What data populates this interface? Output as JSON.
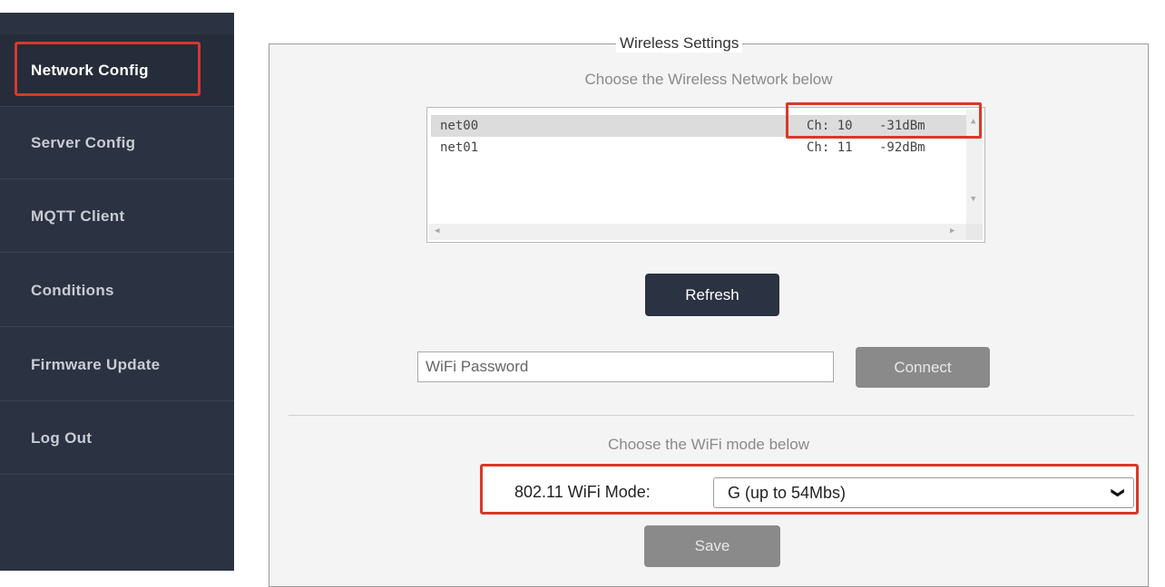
{
  "sidebar": {
    "items": [
      {
        "label": "Network Config",
        "active": true
      },
      {
        "label": "Server Config"
      },
      {
        "label": "MQTT Client"
      },
      {
        "label": "Conditions"
      },
      {
        "label": "Firmware Update"
      },
      {
        "label": "Log Out"
      }
    ]
  },
  "wireless": {
    "legend": "Wireless Settings",
    "choose_network": "Choose the Wireless Network below",
    "networks": [
      {
        "name": "net00",
        "channel": "Ch: 10",
        "signal": "-31dBm",
        "selected": true
      },
      {
        "name": "net01",
        "channel": "Ch: 11",
        "signal": "-92dBm"
      }
    ],
    "refresh_label": "Refresh",
    "password_placeholder": "WiFi Password",
    "connect_label": "Connect",
    "choose_mode": "Choose the WiFi mode below",
    "mode_label": "802.11 WiFi Mode:",
    "mode_value": "G (up to 54Mbs)",
    "save_label": "Save"
  },
  "colors": {
    "sidebar_bg": "#2b3241",
    "highlight": "#d9382b",
    "button_dark": "#2b3241",
    "button_disabled": "#8a8a8a"
  }
}
